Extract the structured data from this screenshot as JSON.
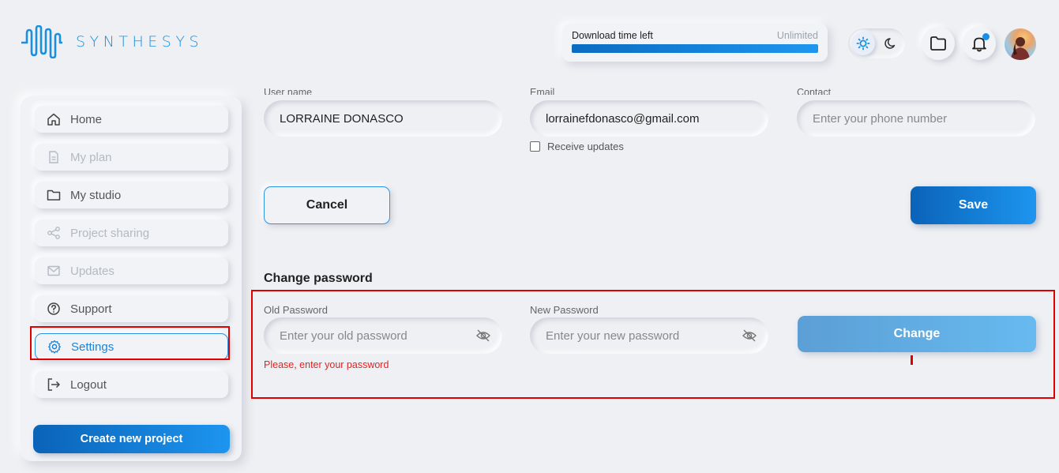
{
  "brand": {
    "name": "SYNTHESYS"
  },
  "download": {
    "label": "Download time left",
    "value": "Unlimited",
    "progress_percent": 100
  },
  "sidebar": {
    "items": [
      {
        "label": "Home",
        "icon": "home-icon",
        "state": "normal"
      },
      {
        "label": "My plan",
        "icon": "document-icon",
        "state": "disabled"
      },
      {
        "label": "My studio",
        "icon": "folder-icon",
        "state": "normal"
      },
      {
        "label": "Project sharing",
        "icon": "share-icon",
        "state": "disabled"
      },
      {
        "label": "Updates",
        "icon": "mail-icon",
        "state": "disabled"
      },
      {
        "label": "Support",
        "icon": "help-icon",
        "state": "normal"
      },
      {
        "label": "Settings",
        "icon": "gear-icon",
        "state": "active"
      },
      {
        "label": "Logout",
        "icon": "logout-icon",
        "state": "normal"
      }
    ],
    "create_label": "Create new project"
  },
  "profile": {
    "username_label": "User name",
    "username_value": "LORRAINE DONASCO",
    "email_label": "Email",
    "email_value": "lorrainefdonasco@gmail.com",
    "contact_label": "Contact",
    "contact_placeholder": "Enter your phone number",
    "receive_updates_label": "Receive updates",
    "receive_updates_checked": false
  },
  "actions": {
    "cancel_label": "Cancel",
    "save_label": "Save"
  },
  "password": {
    "title": "Change password",
    "old_label": "Old Password",
    "old_placeholder": "Enter your old password",
    "new_label": "New Password",
    "new_placeholder": "Enter your new password",
    "error": "Please, enter your password",
    "change_label": "Change"
  },
  "colors": {
    "accent": "#1a8fe0",
    "error": "#e02424",
    "highlight": "#e00000"
  }
}
